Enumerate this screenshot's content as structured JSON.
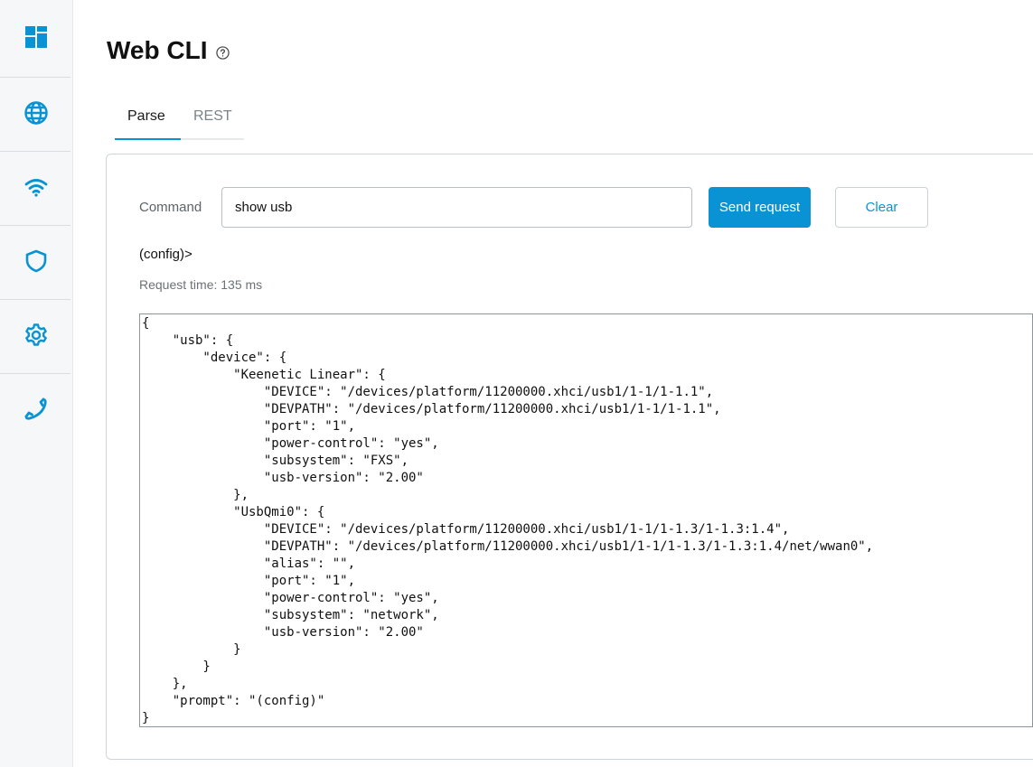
{
  "page": {
    "title": "Web CLI",
    "help_icon": "help-circle-icon"
  },
  "sidebar": {
    "items": [
      {
        "name": "dashboard",
        "icon": "dashboard-icon"
      },
      {
        "name": "internet",
        "icon": "globe-icon"
      },
      {
        "name": "wifi",
        "icon": "wifi-icon"
      },
      {
        "name": "security",
        "icon": "shield-icon"
      },
      {
        "name": "settings",
        "icon": "gear-icon"
      },
      {
        "name": "telephony",
        "icon": "phone-icon"
      }
    ]
  },
  "tabs": [
    {
      "label": "Parse",
      "active": true
    },
    {
      "label": "REST",
      "active": false
    }
  ],
  "form": {
    "command_label": "Command",
    "command_value": "show usb",
    "send_label": "Send request",
    "clear_label": "Clear"
  },
  "result": {
    "prompt": "(config)>",
    "request_time": "Request time: 135 ms",
    "output": "{\n    \"usb\": {\n        \"device\": {\n            \"Keenetic Linear\": {\n                \"DEVICE\": \"/devices/platform/11200000.xhci/usb1/1-1/1-1.1\",\n                \"DEVPATH\": \"/devices/platform/11200000.xhci/usb1/1-1/1-1.1\",\n                \"port\": \"1\",\n                \"power-control\": \"yes\",\n                \"subsystem\": \"FXS\",\n                \"usb-version\": \"2.00\"\n            },\n            \"UsbQmi0\": {\n                \"DEVICE\": \"/devices/platform/11200000.xhci/usb1/1-1/1-1.3/1-1.3:1.4\",\n                \"DEVPATH\": \"/devices/platform/11200000.xhci/usb1/1-1/1-1.3/1-1.3:1.4/net/wwan0\",\n                \"alias\": \"\",\n                \"port\": \"1\",\n                \"power-control\": \"yes\",\n                \"subsystem\": \"network\",\n                \"usb-version\": \"2.00\"\n            }\n        }\n    },\n    \"prompt\": \"(config)\"\n}"
  },
  "colors": {
    "accent": "#0a93d4",
    "sidebar_bg": "#f5f7f8"
  }
}
